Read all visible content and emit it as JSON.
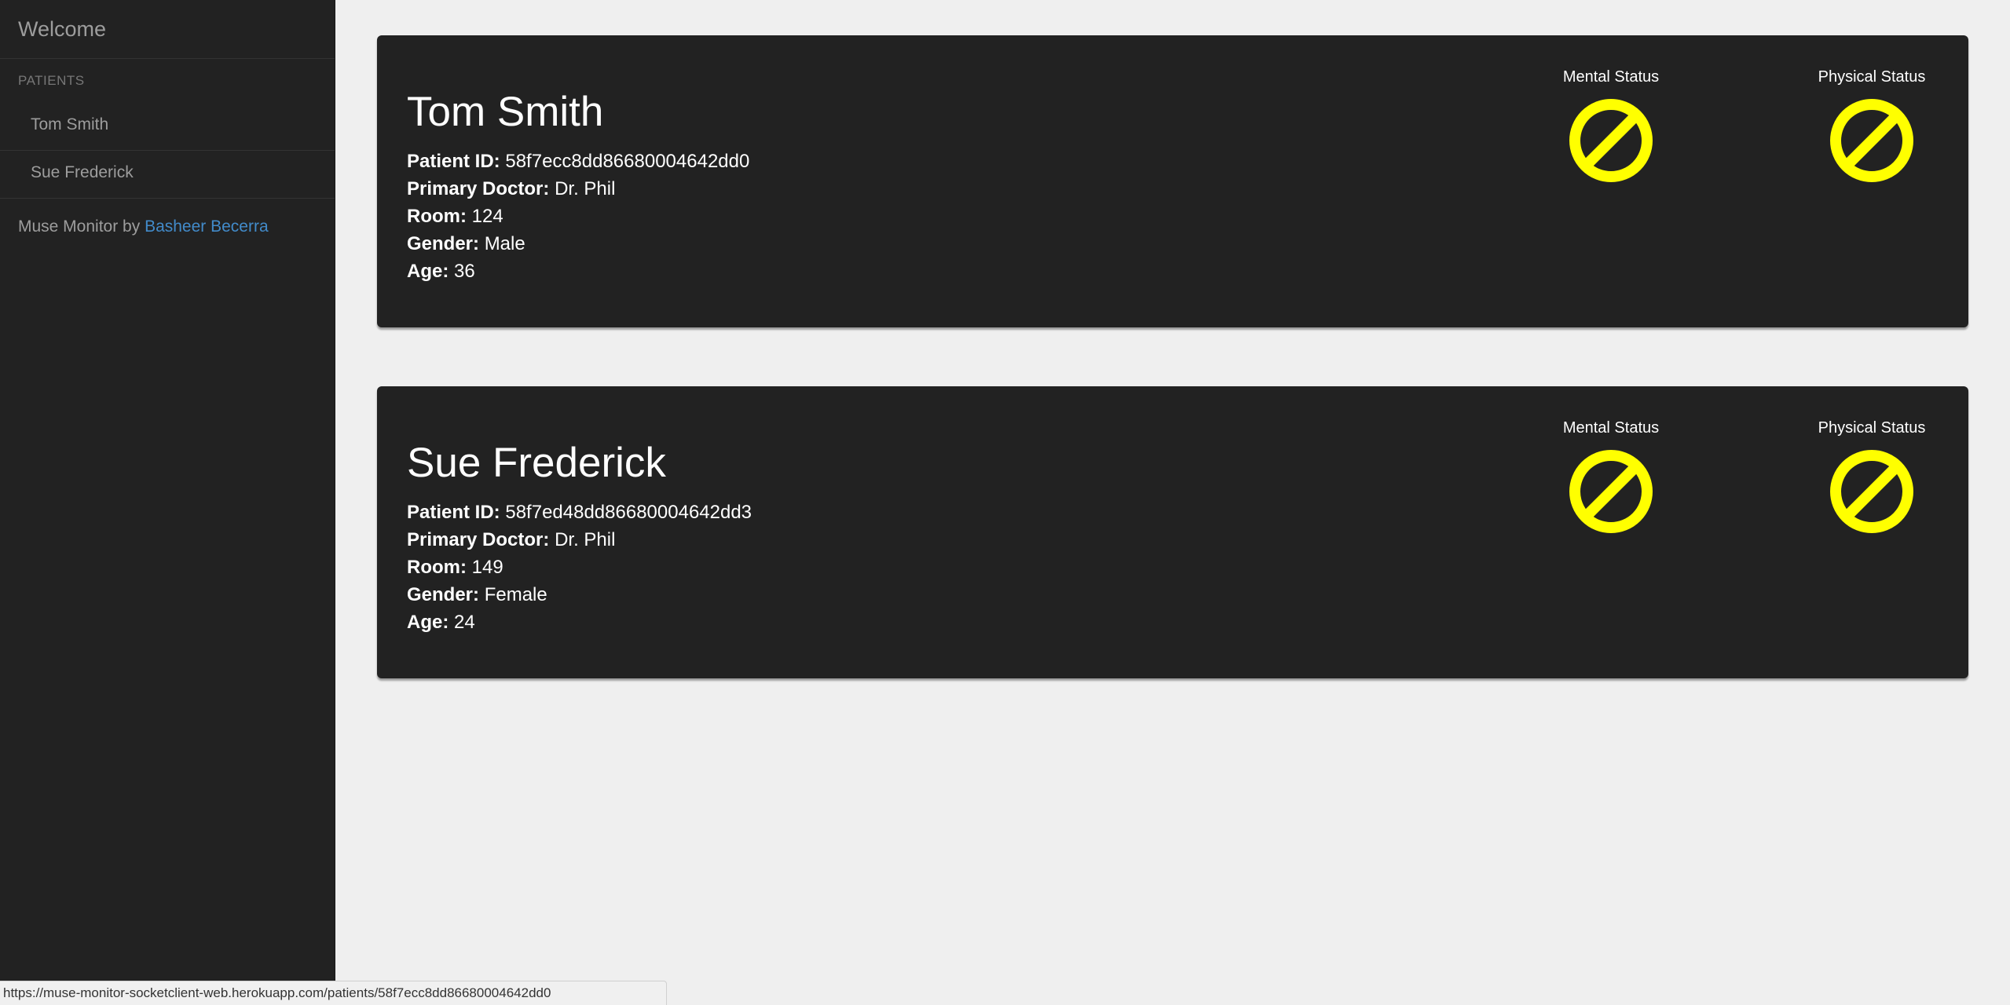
{
  "sidebar": {
    "title": "Welcome",
    "section_header": "PATIENTS",
    "items": [
      {
        "label": "Tom Smith"
      },
      {
        "label": "Sue Frederick"
      }
    ],
    "footer_text": "Muse Monitor by ",
    "footer_link": "Basheer Becerra",
    "link_color": "#428bca"
  },
  "labels": {
    "patient_id": "Patient ID:",
    "primary_doctor": "Primary Doctor:",
    "room": "Room:",
    "gender": "Gender:",
    "age": "Age:",
    "mental_status": "Mental Status",
    "physical_status": "Physical Status"
  },
  "patients": [
    {
      "name": "Tom Smith",
      "patient_id": "58f7ecc8dd86680004642dd0",
      "primary_doctor": "Dr. Phil",
      "room": "124",
      "gender": "Male",
      "age": "36",
      "mental_status_icon": "no-entry-icon",
      "physical_status_icon": "no-entry-icon"
    },
    {
      "name": "Sue Frederick",
      "patient_id": "58f7ed48dd86680004642dd3",
      "primary_doctor": "Dr. Phil",
      "room": "149",
      "gender": "Female",
      "age": "24",
      "mental_status_icon": "no-entry-icon",
      "physical_status_icon": "no-entry-icon"
    }
  ],
  "status_icon_color": "#ffff00",
  "status_bar": {
    "url": "https://muse-monitor-socketclient-web.herokuapp.com/patients/58f7ecc8dd86680004642dd0"
  }
}
